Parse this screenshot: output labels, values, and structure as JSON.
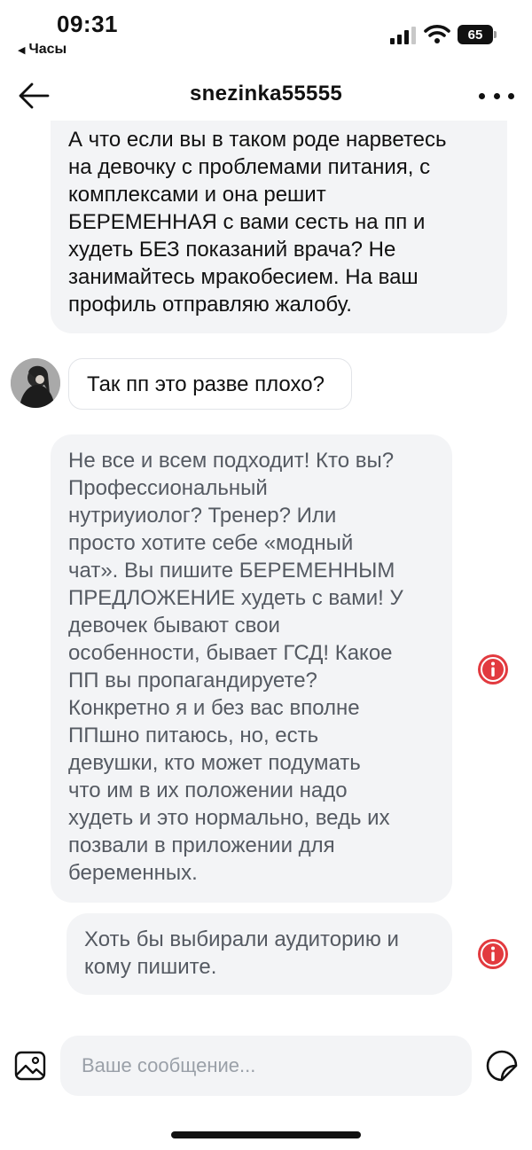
{
  "status_bar": {
    "time": "09:31",
    "back_app": "Часы",
    "battery": "65",
    "signal_icon": "cellular-signal-icon",
    "wifi_icon": "wifi-icon",
    "battery_icon": "battery-icon"
  },
  "header": {
    "title": "snezinka55555",
    "back_icon": "arrow-left-icon",
    "more_icon": "more-horizontal-icon"
  },
  "messages": [
    {
      "id": "m1",
      "type": "own",
      "text": "А что если вы в таком роде нарветесь\nна девочку с проблемами питания, с\nкомплексами и она решит\nБЕРЕМЕННАЯ с вами сесть на пп и\nхудеть БЕЗ показаний врача? Не\nзанимайтесь мракобесием. На ваш\nпрофиль отправляю жалобу."
    },
    {
      "id": "m2",
      "type": "incoming",
      "text": "Так пп это разве плохо?",
      "avatar_icon": "avatar-photo"
    },
    {
      "id": "m3",
      "type": "own-failed",
      "text": "Не все и всем подходит! Кто вы?\nПрофессиональный\nнутриуиолог? Тренер? Или\nпросто хотите себе «модный\nчат». Вы пишите БЕРЕМЕННЫМ\nПРЕДЛОЖЕНИЕ худеть с вами! У\nдевочек бывают свои\nособенности, бывает ГСД! Какое\nПП вы пропагандируете?\nКонкретно я и без вас вполне\nППшно питаюсь, но, есть\nдевушки, кто может подумать\nчто им в их положении надо\nхудеть и это нормально, ведь их\nпозвали в приложении для\nбеременных.",
      "status_icon": "error-info-icon"
    },
    {
      "id": "m4",
      "type": "own-failed",
      "text": "Хоть бы выбирали аудиторию и\nкому пишите.",
      "status_icon": "error-info-icon"
    }
  ],
  "composer": {
    "placeholder": "Ваше сообщение...",
    "gallery_icon": "image-gallery-icon",
    "sticker_icon": "sticker-icon"
  },
  "colors": {
    "bubble": "#f3f4f6",
    "error": "#e23a3f",
    "failed_text": "#555a62"
  }
}
